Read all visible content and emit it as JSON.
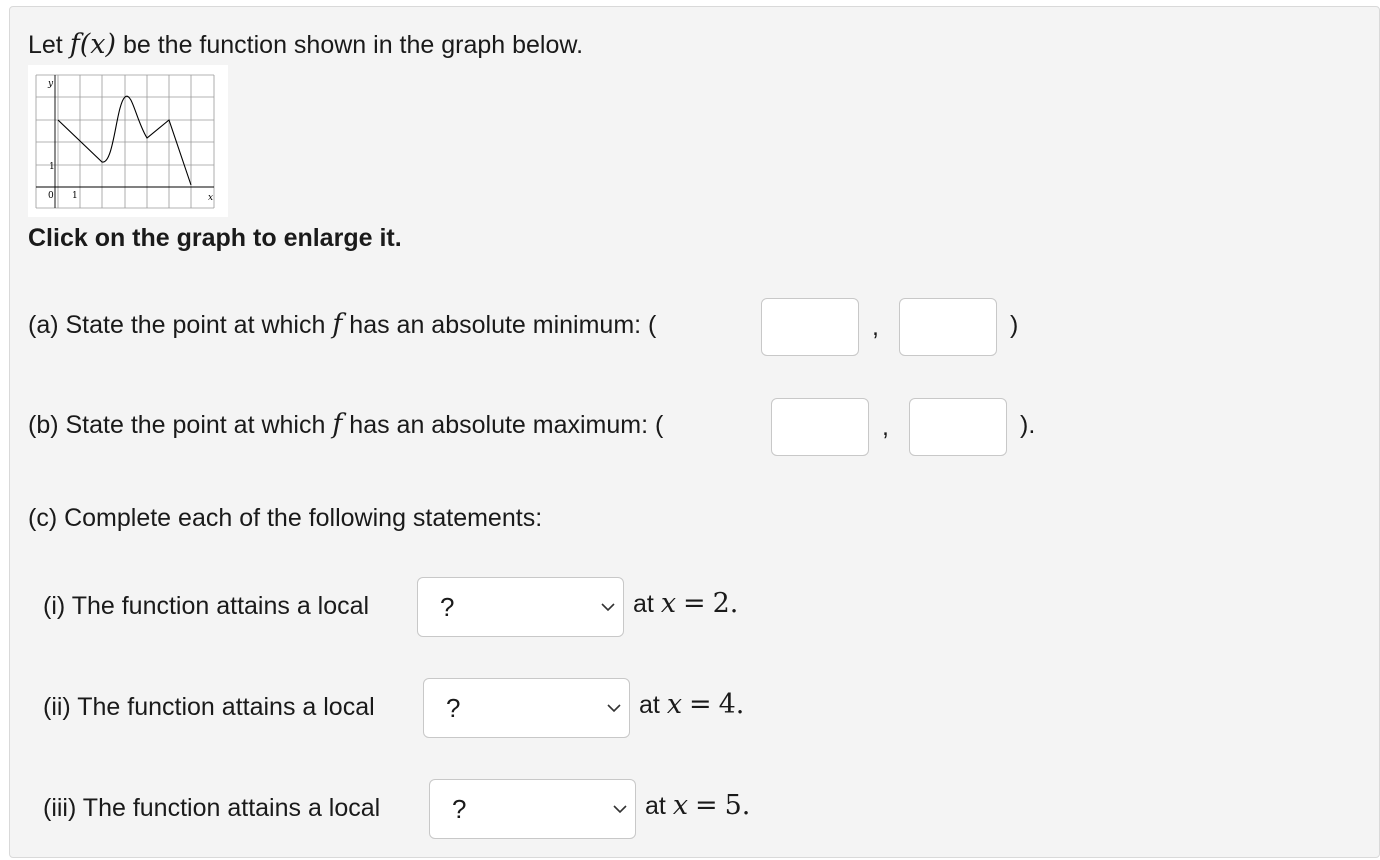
{
  "intro": {
    "lead": "Let",
    "func": "f(x)",
    "tail": "be the function shown in the graph below."
  },
  "graph": {
    "y_label": "y",
    "x_label": "x",
    "tick_zero": "0",
    "tick_one_x": "1",
    "tick_one_y": "1"
  },
  "click_hint": "Click on the graph to enlarge it.",
  "part_a": {
    "lead": "(a) State the point at which",
    "func": "f",
    "tail": "has an absolute minimum: (",
    "comma": ",",
    "close": ")",
    "x_value": "",
    "y_value": ""
  },
  "part_b": {
    "lead": "(b) State the point at which",
    "func": "f",
    "tail": "has an absolute maximum: (",
    "comma": ",",
    "close": ").",
    "x_value": "",
    "y_value": ""
  },
  "part_c": {
    "heading": "(c) Complete each of the following statements:",
    "items": [
      {
        "label": "(i) The function attains a local",
        "selected": "?",
        "at": "at",
        "var": "x",
        "eq": "=",
        "num": "2."
      },
      {
        "label": "(ii) The function attains a local",
        "selected": "?",
        "at": "at",
        "var": "x",
        "eq": "=",
        "num": "4."
      },
      {
        "label": "(iii) The function attains a local",
        "selected": "?",
        "at": "at",
        "var": "x",
        "eq": "=",
        "num": "5."
      }
    ]
  },
  "colors": {
    "panel_bg": "#f4f4f4",
    "border": "#c8c8c8",
    "text": "#1a1a1a"
  },
  "icons": {
    "dropdown_chevron": "chevron-down-icon"
  }
}
